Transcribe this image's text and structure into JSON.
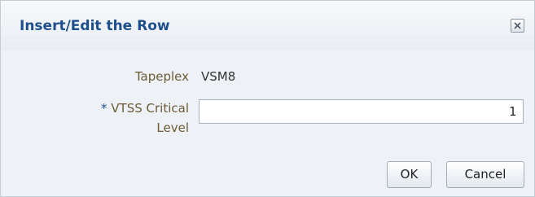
{
  "dialog": {
    "title": "Insert/Edit the Row",
    "close_icon": "close-x-icon"
  },
  "form": {
    "tapeplex_label": "Tapeplex",
    "tapeplex_value": "VSM8",
    "vtss_required_marker": "*",
    "vtss_label_line1": "VTSS Critical",
    "vtss_label_line2": "Level",
    "vtss_value": "1"
  },
  "buttons": {
    "ok_label": "OK",
    "cancel_label": "Cancel"
  },
  "colors": {
    "title": "#1e4f8b",
    "label": "#6b5c36"
  }
}
